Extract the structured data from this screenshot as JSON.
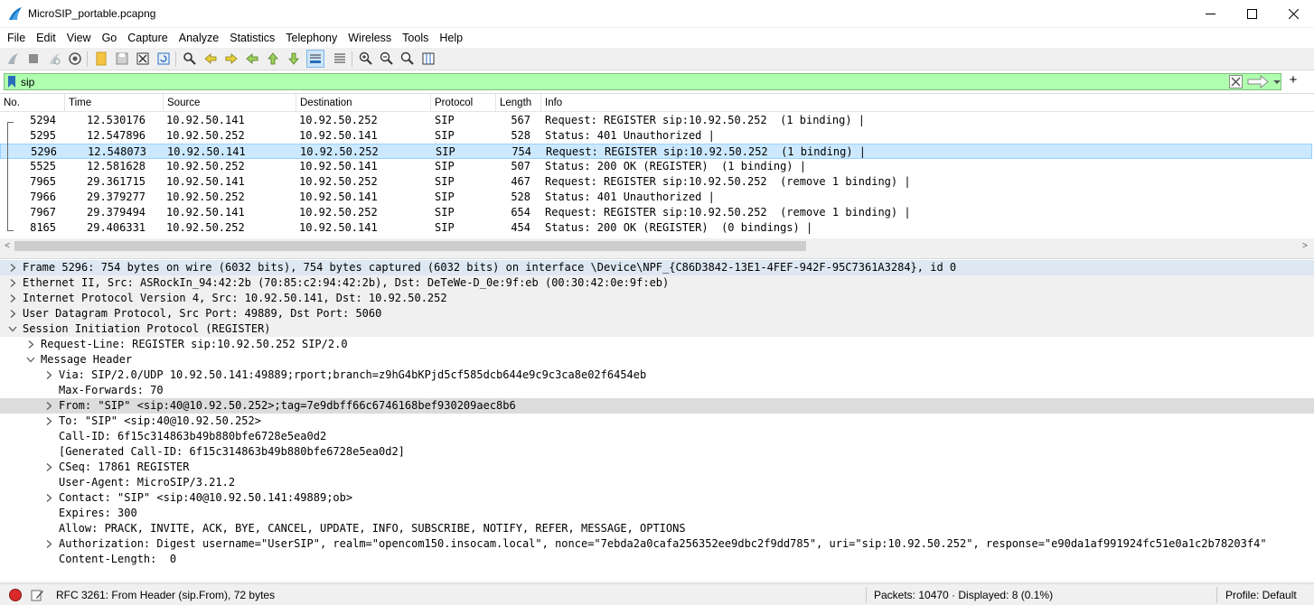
{
  "window": {
    "title": "MicroSIP_portable.pcapng",
    "minimize_glyph": "—",
    "maximize_glyph": "☐",
    "close_glyph": "✕"
  },
  "menu": [
    "File",
    "Edit",
    "View",
    "Go",
    "Capture",
    "Analyze",
    "Statistics",
    "Telephony",
    "Wireless",
    "Tools",
    "Help"
  ],
  "toolbar": {
    "icons": [
      "start-capture-icon",
      "stop-capture-icon",
      "restart-capture-icon",
      "capture-options-icon",
      "open-file-icon",
      "save-file-icon",
      "close-file-icon",
      "reload-file-icon",
      "find-packet-icon",
      "go-back-icon",
      "go-forward-icon",
      "go-to-packet-icon",
      "go-first-icon",
      "go-last-icon",
      "auto-scroll-icon",
      "colorize-icon",
      "zoom-in-icon",
      "zoom-out-icon",
      "normal-size-icon",
      "resize-columns-icon"
    ]
  },
  "filter": {
    "value": "sip",
    "bg_color": "#afffaf",
    "add_glyph": "+"
  },
  "packet_list": {
    "columns": [
      "No.",
      "Time",
      "Source",
      "Destination",
      "Protocol",
      "Length",
      "Info"
    ],
    "rows": [
      {
        "no": "5294",
        "time": "12.530176",
        "src": "10.92.50.141",
        "dst": "10.92.50.252",
        "proto": "SIP",
        "len": "567",
        "info": "Request: REGISTER sip:10.92.50.252  (1 binding) |",
        "selected": false
      },
      {
        "no": "5295",
        "time": "12.547896",
        "src": "10.92.50.252",
        "dst": "10.92.50.141",
        "proto": "SIP",
        "len": "528",
        "info": "Status: 401 Unauthorized |",
        "selected": false
      },
      {
        "no": "5296",
        "time": "12.548073",
        "src": "10.92.50.141",
        "dst": "10.92.50.252",
        "proto": "SIP",
        "len": "754",
        "info": "Request: REGISTER sip:10.92.50.252  (1 binding) |",
        "selected": true
      },
      {
        "no": "5525",
        "time": "12.581628",
        "src": "10.92.50.252",
        "dst": "10.92.50.141",
        "proto": "SIP",
        "len": "507",
        "info": "Status: 200 OK (REGISTER)  (1 binding) |",
        "selected": false
      },
      {
        "no": "7965",
        "time": "29.361715",
        "src": "10.92.50.141",
        "dst": "10.92.50.252",
        "proto": "SIP",
        "len": "467",
        "info": "Request: REGISTER sip:10.92.50.252  (remove 1 binding) |",
        "selected": false
      },
      {
        "no": "7966",
        "time": "29.379277",
        "src": "10.92.50.252",
        "dst": "10.92.50.141",
        "proto": "SIP",
        "len": "528",
        "info": "Status: 401 Unauthorized |",
        "selected": false
      },
      {
        "no": "7967",
        "time": "29.379494",
        "src": "10.92.50.141",
        "dst": "10.92.50.252",
        "proto": "SIP",
        "len": "654",
        "info": "Request: REGISTER sip:10.92.50.252  (remove 1 binding) |",
        "selected": false
      },
      {
        "no": "8165",
        "time": "29.406331",
        "src": "10.92.50.252",
        "dst": "10.92.50.141",
        "proto": "SIP",
        "len": "454",
        "info": "Status: 200 OK (REGISTER)  (0 bindings) |",
        "selected": false
      }
    ],
    "scroll_left": "<",
    "scroll_right": ">"
  },
  "details": [
    {
      "level": 0,
      "toggle": "collapsed",
      "style": "frame",
      "text": "Frame 5296: 754 bytes on wire (6032 bits), 754 bytes captured (6032 bits) on interface \\Device\\NPF_{C86D3842-13E1-4FEF-942F-95C7361A3284}, id 0"
    },
    {
      "level": 0,
      "toggle": "collapsed",
      "style": "grey",
      "text": "Ethernet II, Src: ASRockIn_94:42:2b (70:85:c2:94:42:2b), Dst: DeTeWe-D_0e:9f:eb (00:30:42:0e:9f:eb)"
    },
    {
      "level": 0,
      "toggle": "collapsed",
      "style": "grey",
      "text": "Internet Protocol Version 4, Src: 10.92.50.141, Dst: 10.92.50.252"
    },
    {
      "level": 0,
      "toggle": "collapsed",
      "style": "grey",
      "text": "User Datagram Protocol, Src Port: 49889, Dst Port: 5060"
    },
    {
      "level": 0,
      "toggle": "expanded",
      "style": "grey",
      "text": "Session Initiation Protocol (REGISTER)"
    },
    {
      "level": 1,
      "toggle": "collapsed",
      "style": "",
      "text": "Request-Line: REGISTER sip:10.92.50.252 SIP/2.0"
    },
    {
      "level": 1,
      "toggle": "expanded",
      "style": "",
      "text": "Message Header"
    },
    {
      "level": 2,
      "toggle": "collapsed",
      "style": "",
      "text": "Via: SIP/2.0/UDP 10.92.50.141:49889;rport;branch=z9hG4bKPjd5cf585dcb644e9c9c3ca8e02f6454eb"
    },
    {
      "level": 2,
      "toggle": "none",
      "style": "",
      "text": "Max-Forwards: 70"
    },
    {
      "level": 2,
      "toggle": "collapsed",
      "style": "field",
      "text": "From: \"SIP\" <sip:40@10.92.50.252>;tag=7e9dbff66c6746168bef930209aec8b6"
    },
    {
      "level": 2,
      "toggle": "collapsed",
      "style": "",
      "text": "To: \"SIP\" <sip:40@10.92.50.252>"
    },
    {
      "level": 2,
      "toggle": "none",
      "style": "",
      "text": "Call-ID: 6f15c314863b49b880bfe6728e5ea0d2"
    },
    {
      "level": 2,
      "toggle": "none",
      "style": "",
      "text": "[Generated Call-ID: 6f15c314863b49b880bfe6728e5ea0d2]"
    },
    {
      "level": 2,
      "toggle": "collapsed",
      "style": "",
      "text": "CSeq: 17861 REGISTER"
    },
    {
      "level": 2,
      "toggle": "none",
      "style": "",
      "text": "User-Agent: MicroSIP/3.21.2"
    },
    {
      "level": 2,
      "toggle": "collapsed",
      "style": "",
      "text": "Contact: \"SIP\" <sip:40@10.92.50.141:49889;ob>"
    },
    {
      "level": 2,
      "toggle": "none",
      "style": "",
      "text": "Expires: 300"
    },
    {
      "level": 2,
      "toggle": "none",
      "style": "",
      "text": "Allow: PRACK, INVITE, ACK, BYE, CANCEL, UPDATE, INFO, SUBSCRIBE, NOTIFY, REFER, MESSAGE, OPTIONS"
    },
    {
      "level": 2,
      "toggle": "collapsed",
      "style": "",
      "text": "Authorization: Digest username=\"UserSIP\", realm=\"opencom150.insocam.local\", nonce=\"7ebda2a0cafa256352ee9dbc2f9dd785\", uri=\"sip:10.92.50.252\", response=\"e90da1af991924fc51e0a1c2b78203f4\""
    },
    {
      "level": 2,
      "toggle": "none",
      "style": "",
      "text": "Content-Length:  0"
    }
  ],
  "status": {
    "field_info": "RFC 3261: From Header (sip.From), 72 bytes",
    "packets": "Packets: 10470 · Displayed: 8 (0.1%)",
    "profile": "Profile: Default",
    "expert_color": "#d92b2b"
  }
}
